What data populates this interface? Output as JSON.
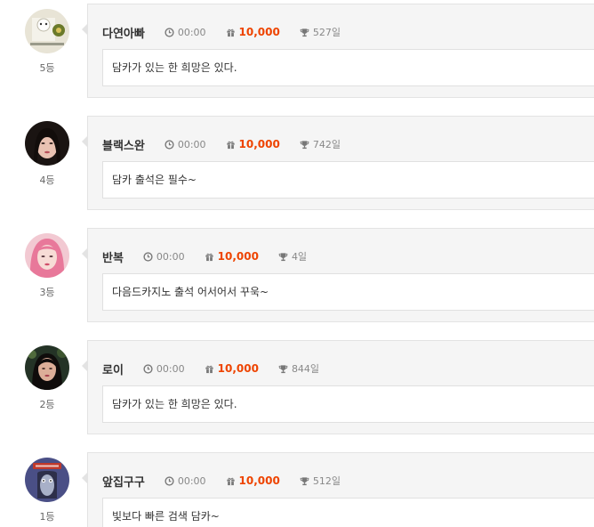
{
  "entries": [
    {
      "name": "다연아빠",
      "time": "00:00",
      "points": "10,000",
      "streak": "527일",
      "message": "담카가 있는 한 희망은 있다.",
      "rank": "5등"
    },
    {
      "name": "블랙스완",
      "time": "00:00",
      "points": "10,000",
      "streak": "742일",
      "message": "담카 출석은 필수~",
      "rank": "4등"
    },
    {
      "name": "반복",
      "time": "00:00",
      "points": "10,000",
      "streak": "4일",
      "message": "다음드카지노 출석 어서어서 꾸욱~",
      "rank": "3등"
    },
    {
      "name": "로이",
      "time": "00:00",
      "points": "10,000",
      "streak": "844일",
      "message": "담카가 있는 한 희망은 있다.",
      "rank": "2등"
    },
    {
      "name": "앞집구구",
      "time": "00:00",
      "points": "10,000",
      "streak": "512일",
      "message": "빛보다 빠른 검색 담카~",
      "rank": "1등"
    }
  ],
  "icons": {
    "time": "clock-icon",
    "points": "gift-icon",
    "streak": "trophy-icon"
  },
  "colors": {
    "points": "#ee4400",
    "card_bg": "#f5f5f5",
    "border": "#e3e3e3"
  }
}
